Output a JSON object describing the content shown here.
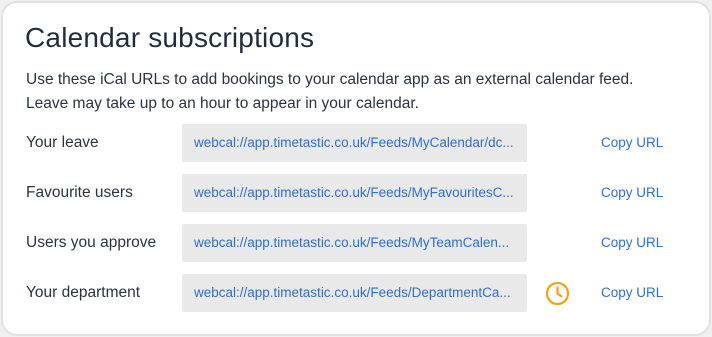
{
  "panel": {
    "title": "Calendar subscriptions",
    "description_line1": "Use these iCal URLs to add bookings to your calendar app as an external calendar feed.",
    "description_line2": "Leave may take up to an hour to appear in your calendar."
  },
  "subscriptions": [
    {
      "label": "Your leave",
      "url": "webcal://app.timetastic.co.uk/Feeds/MyCalendar/dc...",
      "copy_label": "Copy URL",
      "pending": false
    },
    {
      "label": "Favourite users",
      "url": "webcal://app.timetastic.co.uk/Feeds/MyFavouritesC...",
      "copy_label": "Copy URL",
      "pending": false
    },
    {
      "label": "Users you approve",
      "url": "webcal://app.timetastic.co.uk/Feeds/MyTeamCalen...",
      "copy_label": "Copy URL",
      "pending": false
    },
    {
      "label": "Your department",
      "url": "webcal://app.timetastic.co.uk/Feeds/DepartmentCa...",
      "copy_label": "Copy URL",
      "pending": true,
      "pending_icon": "clock-icon"
    }
  ],
  "colors": {
    "link": "#2f6fd1",
    "pending_icon": "#f2a11b",
    "field_background": "#e9e9e9"
  }
}
